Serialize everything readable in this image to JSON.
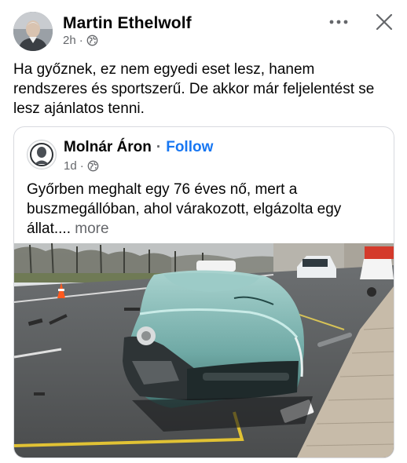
{
  "post": {
    "author": "Martin Ethelwolf",
    "time": "2h",
    "text": "Ha győznek, ez nem egyedi eset lesz, hanem rendszeres és sportszerű. De akkor már feljelentést se lesz ajánlatos tenni."
  },
  "icons": {
    "more": "more-horizontal-icon",
    "close": "close-icon",
    "privacy": "globe-icon"
  },
  "shared": {
    "author": "Molnár Áron",
    "separator": "·",
    "follow_label": "Follow",
    "time": "1d",
    "text": "Győrben meghalt egy 76 éves nő, mert a buszmegállóban, ahol várakozott, elgázolta egy állat....",
    "more_label": "more"
  },
  "colors": {
    "link": "#1877f2",
    "secondary_text": "#65676b",
    "card_border": "#d8dadf",
    "car_body": "#7fb8b4"
  }
}
